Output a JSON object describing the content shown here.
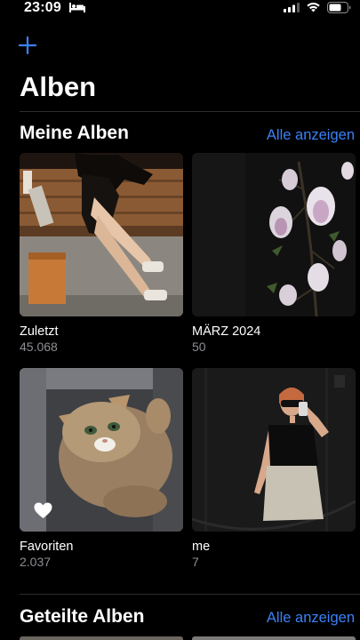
{
  "status_bar": {
    "time": "23:09",
    "icons": [
      "bed-icon",
      "signal-icon",
      "wifi-icon",
      "battery-icon"
    ]
  },
  "toolbar": {
    "add_icon": "plus-icon"
  },
  "page": {
    "title": "Alben"
  },
  "my_albums": {
    "title": "Meine Alben",
    "see_all": "Alle anzeigen",
    "albums": [
      {
        "name": "Zuletzt",
        "count": "45.068"
      },
      {
        "name": "MÄRZ 2024",
        "count": "50"
      },
      {
        "name": "Favoriten",
        "count": "2.037",
        "badge_icon": "heart-icon"
      },
      {
        "name": "me",
        "count": "7"
      }
    ]
  },
  "shared_albums": {
    "title": "Geteilte Alben",
    "see_all": "Alle anzeigen"
  },
  "colors": {
    "accent": "#3a82f7",
    "background": "#000000",
    "secondary_text": "#8e8e93"
  }
}
